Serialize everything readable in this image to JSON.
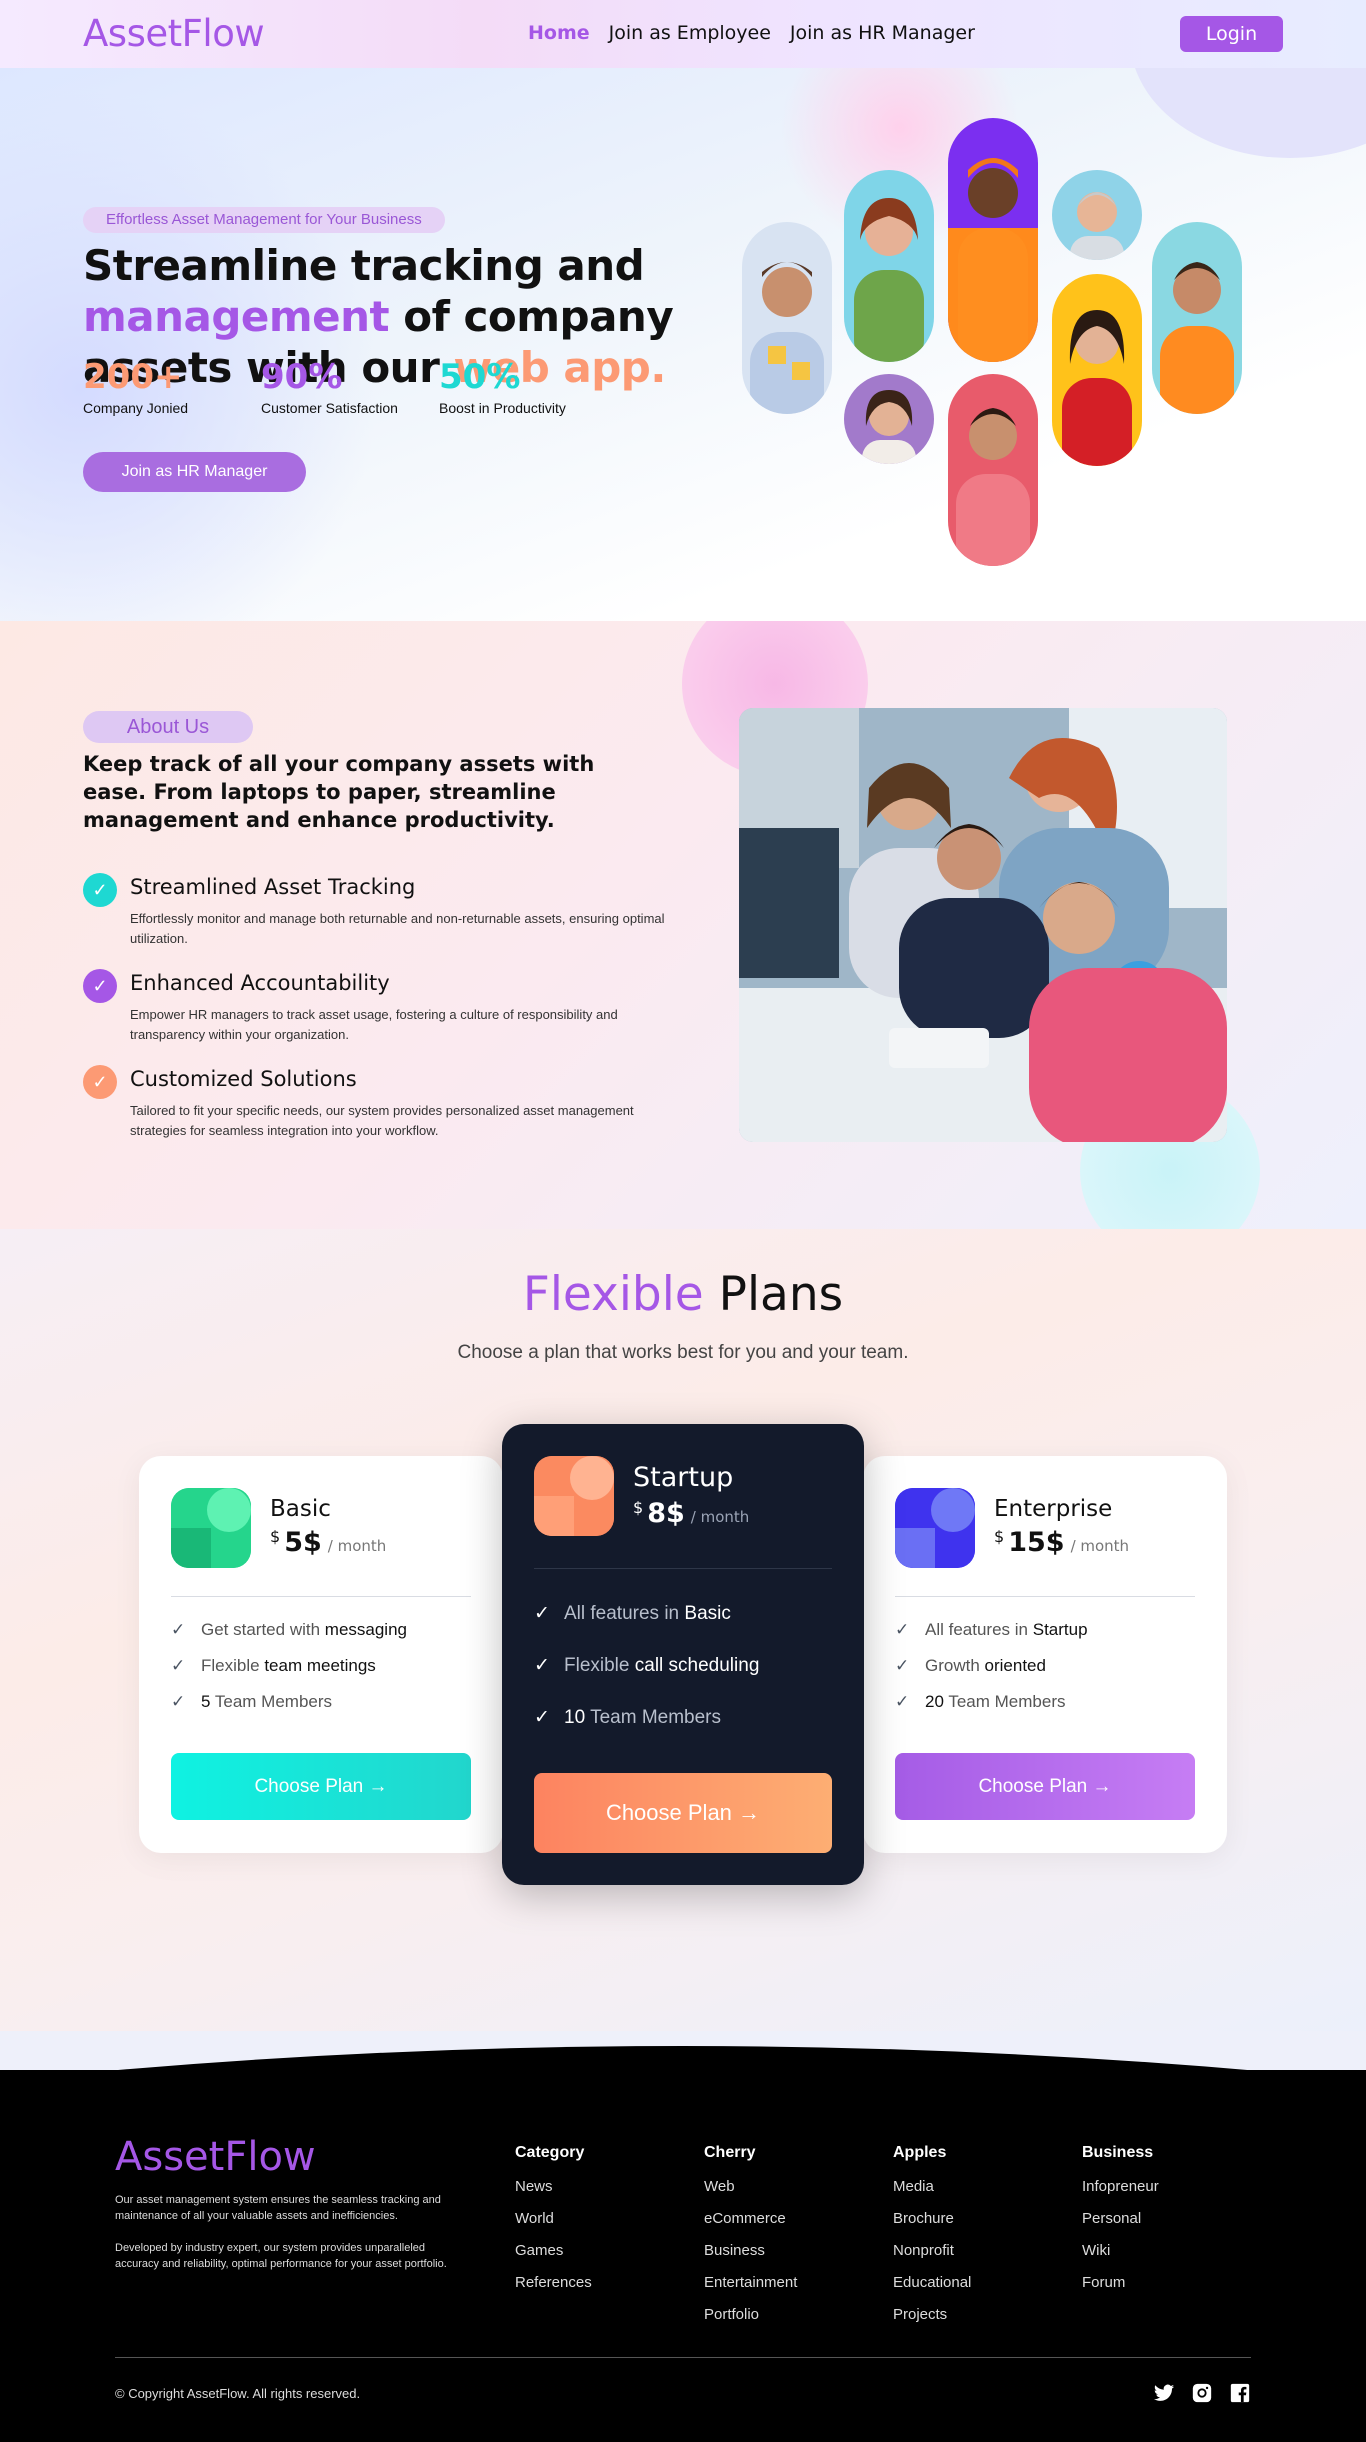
{
  "nav": {
    "logo": "AssetFlow",
    "links": [
      "Home",
      "Join as Employee",
      "Join as HR Manager"
    ],
    "login": "Login"
  },
  "hero": {
    "badge": "Effortless Asset Management for Your Business",
    "title_line1": "Streamline tracking and",
    "title_highlight": "management",
    "title_line2_rest": " of company",
    "title_line3": "assets with our ",
    "title_highlight2": "web app.",
    "stats": [
      {
        "value": "200+",
        "label": "Company Jonied",
        "color": "#fc9a74"
      },
      {
        "value": "90%",
        "label": "Customer Satisfaction",
        "color": "#a557e6"
      },
      {
        "value": "50%",
        "label": "Boost in Productivity",
        "color": "#1ed8d2"
      }
    ],
    "cta": "Join as HR Manager",
    "slides": 2,
    "active_slide": 1
  },
  "about": {
    "badge": "About Us",
    "title": "Keep track of all your company assets with ease. From laptops to paper, streamline management and enhance productivity.",
    "features": [
      {
        "title": "Streamlined Asset Tracking",
        "desc": "Effortlessly monitor and manage both returnable and non-returnable assets, ensuring optimal utilization.",
        "color": "#1ed8d2"
      },
      {
        "title": "Enhanced Accountability",
        "desc": "Empower HR managers to track asset usage, fostering a culture of responsibility and transparency within your organization.",
        "color": "#a557e6"
      },
      {
        "title": "Customized Solutions",
        "desc": "Tailored to fit your specific needs, our system provides personalized asset management strategies for seamless integration into your workflow.",
        "color": "#fc9a74"
      }
    ]
  },
  "plans": {
    "title_highlight": "Flexible",
    "title_rest": " Plans",
    "subtitle": "Choose a plan that works best for you and your team.",
    "currency": "$",
    "period": "/ month",
    "button": "Choose Plan",
    "items": [
      {
        "name": "Basic",
        "price": "5$",
        "features": [
          [
            "Get started with ",
            "messaging"
          ],
          [
            "Flexible ",
            "team meetings"
          ],
          [
            "5",
            " Team Members"
          ]
        ]
      },
      {
        "name": "Startup",
        "price": "8$",
        "features": [
          [
            "All features in ",
            "Basic"
          ],
          [
            "Flexible ",
            "call scheduling"
          ],
          [
            "10",
            " Team Members"
          ]
        ]
      },
      {
        "name": "Enterprise",
        "price": "15$",
        "features": [
          [
            "All features in ",
            "Startup"
          ],
          [
            "Growth ",
            "oriented"
          ],
          [
            "20",
            " Team Members"
          ]
        ]
      }
    ]
  },
  "footer": {
    "logo": "AssetFlow",
    "desc1": "Our asset management system ensures the seamless tracking and maintenance of all your valuable assets and inefficiencies.",
    "desc2": "Developed by industry expert, our system provides unparalleled accuracy and reliability, optimal performance for your asset portfolio.",
    "columns": [
      {
        "title": "Category",
        "items": [
          "News",
          "World",
          "Games",
          "References"
        ]
      },
      {
        "title": "Cherry",
        "items": [
          "Web",
          "eCommerce",
          "Business",
          "Entertainment",
          "Portfolio"
        ]
      },
      {
        "title": "Apples",
        "items": [
          "Media",
          "Brochure",
          "Nonprofit",
          "Educational",
          "Projects"
        ]
      },
      {
        "title": "Business",
        "items": [
          "Infopreneur",
          "Personal",
          "Wiki",
          "Forum"
        ]
      }
    ],
    "copyright": "© Copyright AssetFlow. All rights reserved.",
    "social": [
      "twitter-icon",
      "instagram-icon",
      "facebook-icon"
    ]
  }
}
